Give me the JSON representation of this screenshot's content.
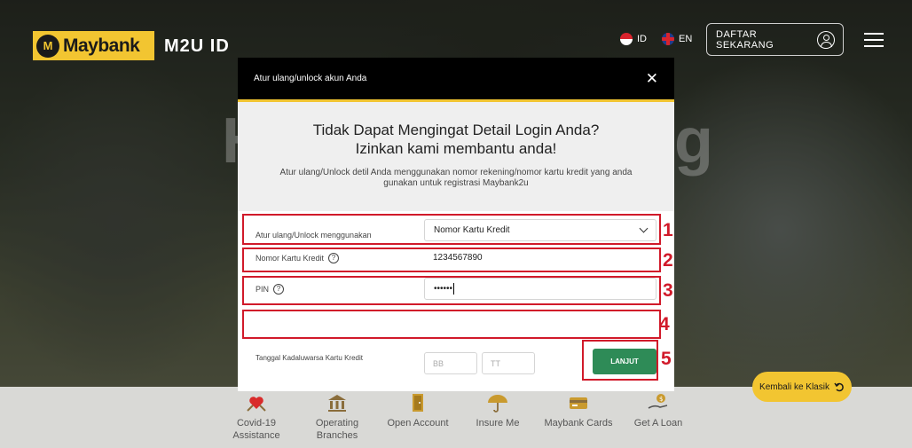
{
  "header": {
    "logo_emblem": "M",
    "logo_text": "Maybank",
    "app_title": "M2U ID",
    "lang_id": "ID",
    "lang_en": "EN",
    "register_label": "DAFTAR SEKARANG"
  },
  "hero": {
    "left_letter": "H",
    "right_letter": "g"
  },
  "modal": {
    "title": "Atur ulang/unlock akun Anda",
    "close": "✕",
    "heading_line1": "Tidak Dapat Mengingat Detail Login Anda?",
    "heading_line2": "Izinkan kami membantu anda!",
    "description": "Atur ulang/Unlock detil Anda menggunakan nomor rekening/nomor kartu kredit yang anda gunakan untuk registrasi Maybank2u",
    "form": {
      "method_label": "Atur ulang/Unlock menggunakan",
      "method_value": "Nomor Kartu Kredit",
      "card_label": "Nomor Kartu Kredit",
      "card_value": "1234567890",
      "pin_label": "PIN",
      "pin_value": "••••••",
      "expiry_label": "Tanggal Kadaluwarsa Kartu Kredit",
      "expiry_month_placeholder": "BB",
      "expiry_year_placeholder": "TT",
      "help_glyph": "?",
      "submit_label": "LANJUT"
    }
  },
  "annotations": [
    "1",
    "2",
    "3",
    "4",
    "5"
  ],
  "quick_links": [
    {
      "line1": "Covid-19",
      "line2": "Assistance",
      "icon": "heart-hands-icon"
    },
    {
      "line1": "Operating",
      "line2": "Branches",
      "icon": "bank-building-icon"
    },
    {
      "line1": "Open Account",
      "line2": "",
      "icon": "door-icon"
    },
    {
      "line1": "Insure Me",
      "line2": "",
      "icon": "umbrella-icon"
    },
    {
      "line1": "Maybank Cards",
      "line2": "",
      "icon": "card-icon"
    },
    {
      "line1": "Get A Loan",
      "line2": "",
      "icon": "money-hand-icon"
    }
  ],
  "back_classic_label": "Kembali ke Klasik",
  "colors": {
    "brand_yellow": "#f2c531",
    "annotation_red": "#d11a2a",
    "submit_green": "#2e8b57"
  }
}
